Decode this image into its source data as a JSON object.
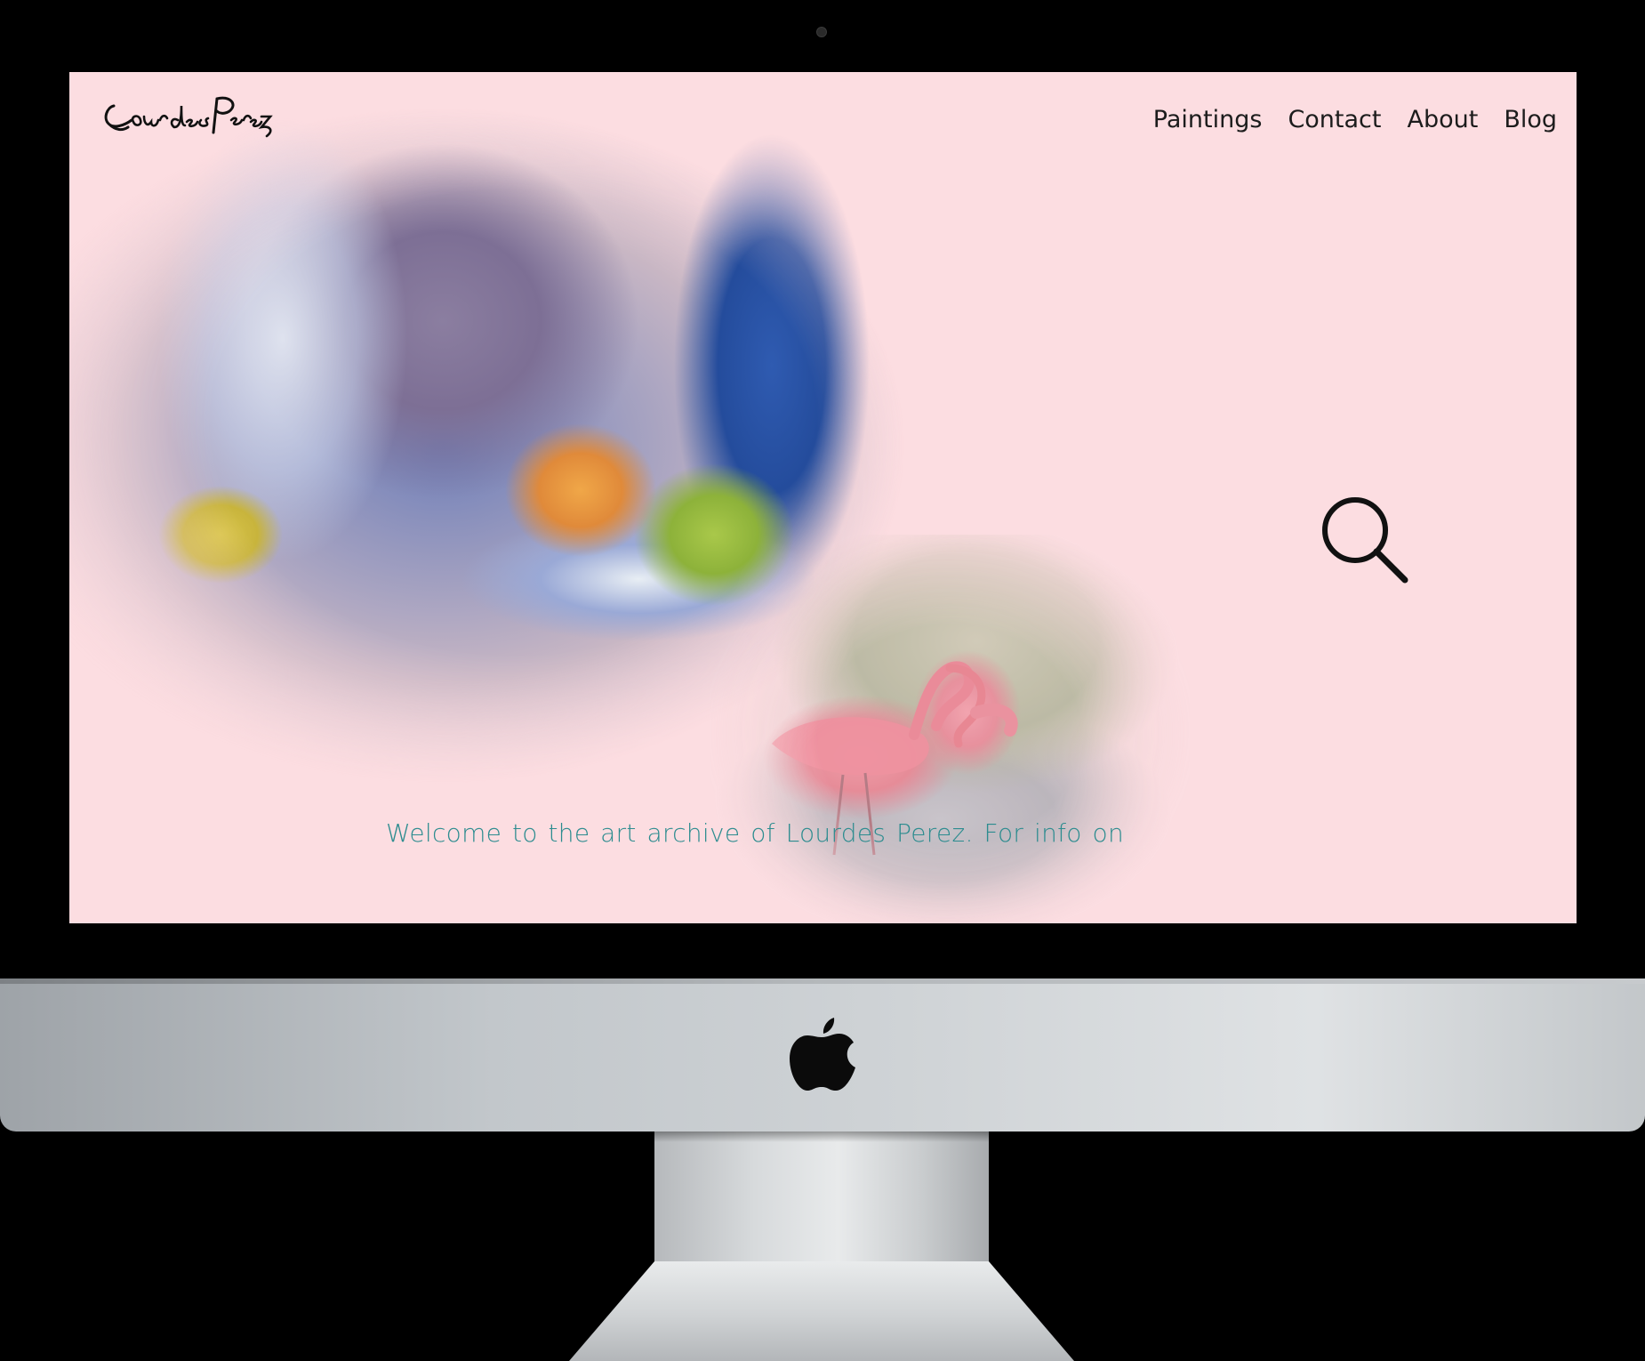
{
  "logo": {
    "text": "Lourdes Perez"
  },
  "nav": {
    "items": [
      {
        "label": "Paintings"
      },
      {
        "label": "Contact"
      },
      {
        "label": "About"
      },
      {
        "label": "Blog"
      }
    ]
  },
  "search": {
    "icon": "search-icon"
  },
  "intro": {
    "text": "Welcome to the art archive of Lourdes Perez. For info on"
  },
  "colors": {
    "page_background": "#fcdde1",
    "nav_text": "#1c1c1c",
    "intro_text": "#2c8c8f"
  },
  "device": {
    "logo_icon": "apple-logo-icon"
  }
}
